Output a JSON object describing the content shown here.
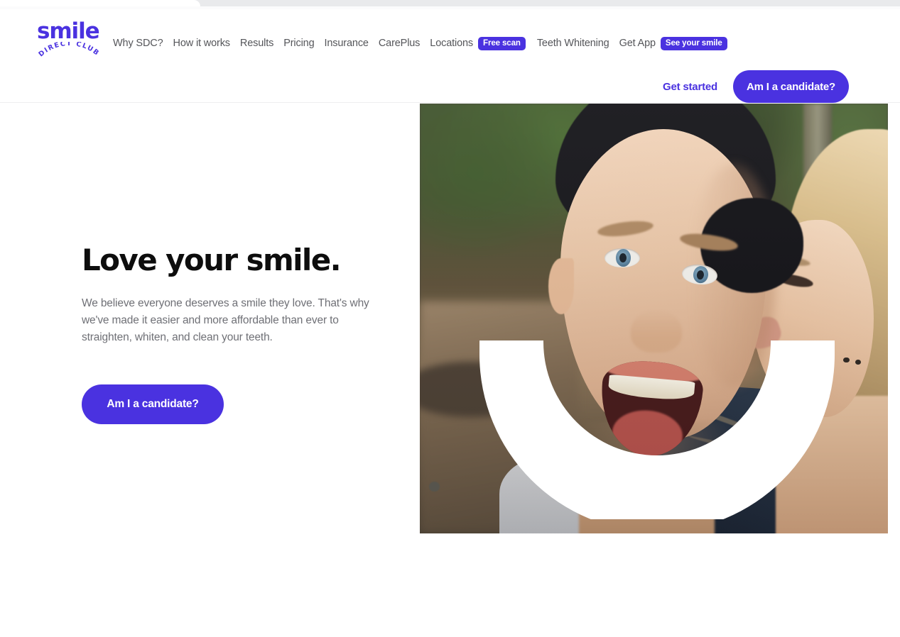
{
  "browser": {
    "active_tab_present": true
  },
  "brand": {
    "logo_word": "smile",
    "logo_arc_text": "DIRECT CLUB",
    "accent_color": "#4A32E0",
    "text_color": "#55565a",
    "heading_color": "#0d0d0d"
  },
  "header": {
    "nav": [
      {
        "label": "Why SDC?",
        "badge": null
      },
      {
        "label": "How it works",
        "badge": null
      },
      {
        "label": "Results",
        "badge": null
      },
      {
        "label": "Pricing",
        "badge": null
      },
      {
        "label": "Insurance",
        "badge": null
      },
      {
        "label": "CarePlus",
        "badge": null
      },
      {
        "label": "Locations",
        "badge": "Free scan"
      },
      {
        "label": "Teeth Whitening",
        "badge": null
      },
      {
        "label": "Get App",
        "badge": "See your smile"
      }
    ],
    "get_started_label": "Get started",
    "candidate_button_label": "Am I a candidate?"
  },
  "hero": {
    "title": "Love your smile.",
    "paragraph": "We believe everyone deserves a smile they love. That's why we've made it easier and more affordable than ever to straighten, whiten, and clean your teeth.",
    "cta_label": "Am I a candidate?",
    "image_alt": "Man in black beanie smiling wide while a blonde woman kisses his cheek outdoors",
    "overlay_shape": "white-smile-arc"
  }
}
